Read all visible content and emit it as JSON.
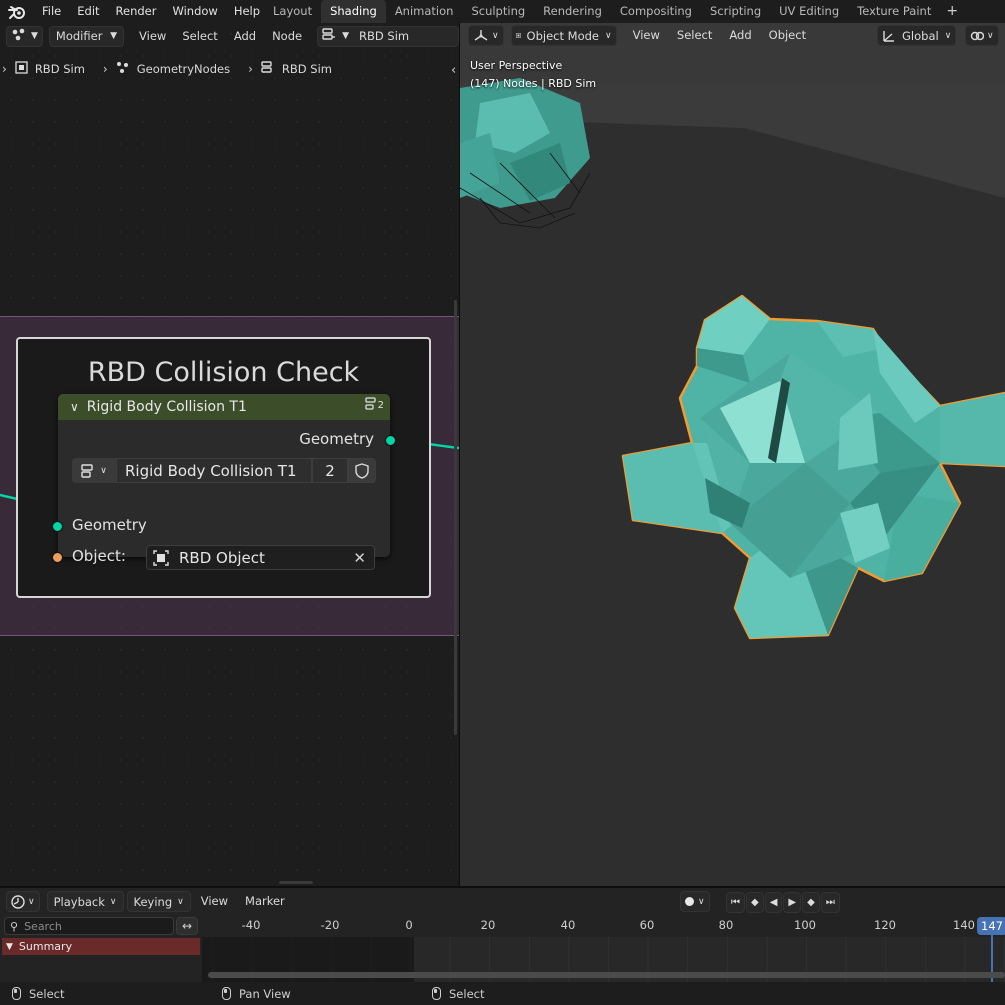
{
  "menu": {
    "items": [
      "File",
      "Edit",
      "Render",
      "Window",
      "Help"
    ]
  },
  "workspaces": {
    "tabs": [
      "Layout",
      "Shading",
      "Animation",
      "Sculpting",
      "Rendering",
      "Compositing",
      "Scripting",
      "UV Editing",
      "Texture Paint"
    ],
    "active": "Shading"
  },
  "node_editor": {
    "header": {
      "editor_type": "Modifier",
      "menus": [
        "View",
        "Select",
        "Add",
        "Node"
      ],
      "node_tree_name": "RBD Sim"
    },
    "breadcrumb": [
      "RBD Sim",
      "GeometryNodes",
      "RBD Sim"
    ],
    "frame_title": "RBD Collision Check",
    "node": {
      "title": "Rigid Body Collision T1",
      "user_count": "2",
      "output_label": "Geometry",
      "group_name": "Rigid Body Collision T1",
      "group_users": "2",
      "input_geometry_label": "Geometry",
      "object_label": "Object:",
      "object_value": "RBD Object"
    }
  },
  "viewport": {
    "header": {
      "mode": "Object Mode",
      "menus": [
        "View",
        "Select",
        "Add",
        "Object"
      ],
      "orientation": "Global"
    },
    "info_line1": "User Perspective",
    "info_line2": "(147) Nodes | RBD Sim",
    "object_color": "#4fb3a6",
    "selection_outline_color": "#f29b30"
  },
  "timeline": {
    "header_menus": [
      "Playback",
      "Keying",
      "View",
      "Marker"
    ],
    "search_placeholder": "Search",
    "summary_label": "Summary",
    "ticks": [
      "-40",
      "-20",
      "0",
      "20",
      "40",
      "60",
      "80",
      "100",
      "120",
      "140"
    ],
    "current_frame": "147"
  },
  "statusbar": {
    "left_action": "Select",
    "middle_action": "Pan View",
    "right_action": "Select"
  },
  "colors": {
    "geometry_socket": "#00d6a3",
    "object_socket": "#ed9e5c",
    "node_header": "#3c4d2a",
    "accent": "#4772b3"
  }
}
